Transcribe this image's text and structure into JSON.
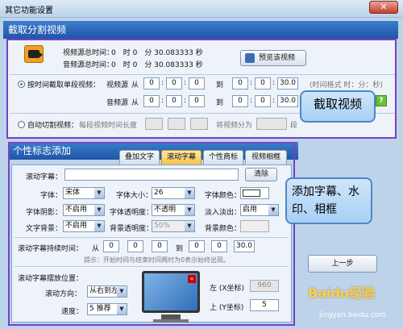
{
  "window": {
    "title": "其它功能设置",
    "close_label": "✕"
  },
  "section1": {
    "header": "截取分割视频",
    "video_total_label": "视频源总时间：",
    "video_total_value": "0　时 0　分 30.083333 秒",
    "audio_total_label": "音频源总时间：",
    "audio_total_value": "0　时 0　分 30.083333 秒",
    "preview_button": "预览该视频",
    "mode_by_time": "按时间截取单段视频：",
    "video_src": "视频源",
    "audio_src": "音频源",
    "from": "从",
    "to": "到",
    "video_from": [
      "0",
      "0",
      "0"
    ],
    "video_to": [
      "0",
      "0",
      "30.0"
    ],
    "audio_from": [
      "0",
      "0",
      "0"
    ],
    "audio_to": [
      "0",
      "0",
      "30.0"
    ],
    "time_format_hint": "(时间格式 时：分：秒)",
    "auto_split_label": "自动切割视频：",
    "auto_split_each_len": "每段视频时间长度",
    "auto_split_into": "将视频分为",
    "auto_split_unit": "段",
    "help_icon": "?"
  },
  "callout1": "截取视频",
  "section2": {
    "header": "个性标志添加",
    "tabs": [
      "叠加文字",
      "滚动字幕",
      "个性商标",
      "视频相框"
    ],
    "active_tab": "滚动字幕",
    "scroll_text_label": "滚动字幕：",
    "scroll_text_value": "",
    "clear_button": "清除",
    "font_label": "字体：",
    "font_value": "宋体",
    "font_size_label": "字体大小：",
    "font_size_value": "26",
    "font_color_label": "字体颜色：",
    "shadow_label": "字体阴影：",
    "shadow_value": "不启用",
    "transparency_label": "字体透明度：",
    "transparency_value": "不透明",
    "fade_label": "淡入淡出：",
    "fade_value": "启用",
    "bg_label": "文字背景：",
    "bg_value": "不启用",
    "bg_transparency_label": "背景透明度：",
    "bg_transparency_value": "50%",
    "bg_color_label": "背景颜色：",
    "duration_label": "滚动字幕持续时间：",
    "from": "从",
    "to": "到",
    "duration_from": [
      "0",
      "0",
      "0"
    ],
    "duration_to": [
      "0",
      "0",
      "30.0"
    ],
    "duration_hint": "提示：开始时间与结束时间两时为0表示始终出现。",
    "position_label": "滚动字幕摆放位置：",
    "direction_label": "滚动方向：",
    "direction_value": "从右到左",
    "speed_label": "速度：",
    "speed_value": "5 推荐",
    "left_label": "左 (X坐标)",
    "left_value": "960",
    "top_label": "上 (Y坐标)",
    "top_value": "5"
  },
  "callout2": "添加字幕、水印、相框",
  "prev_button": "上一步",
  "watermark_text": "Baidu经验",
  "watermark_url": "jingyan.baidu.com",
  "colors": {
    "accent": "#1f55a8",
    "purple": "#7a3fc8",
    "tab_active": "#f6c34c"
  }
}
